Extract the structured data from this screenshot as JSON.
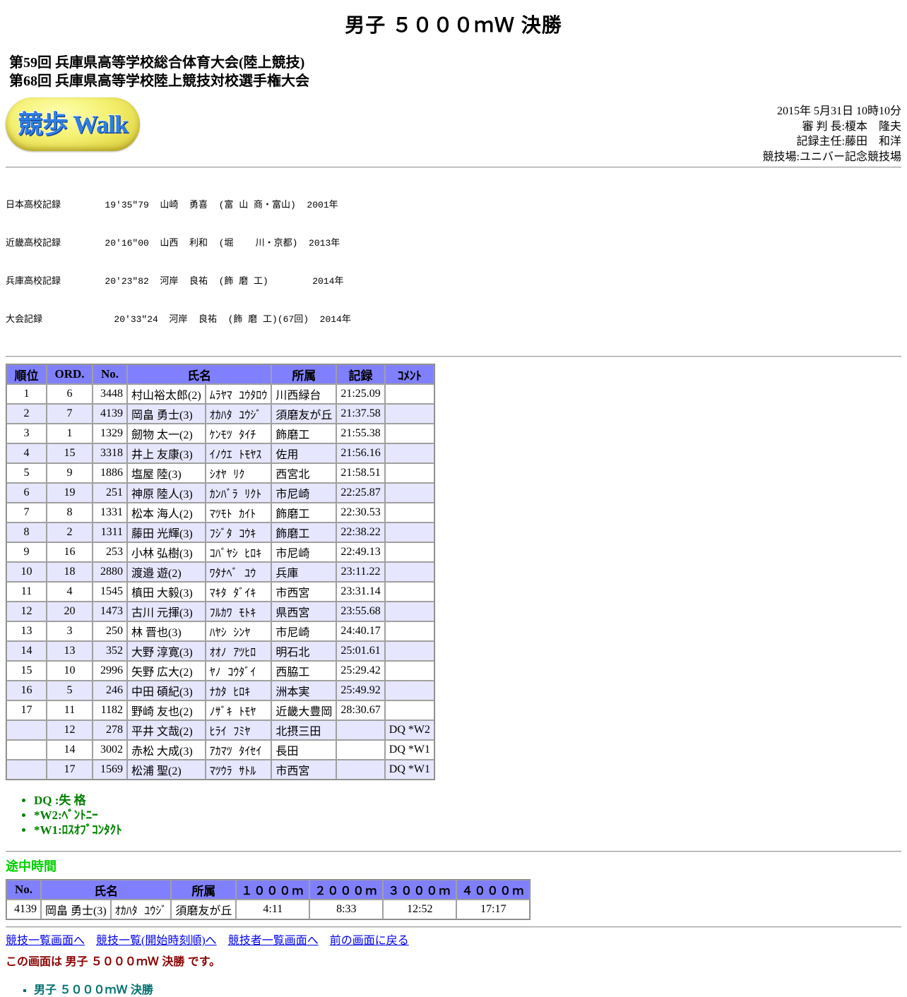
{
  "title": "男子 ５０００ｍＷ 決勝",
  "meet": {
    "line1": "第59回 兵庫県高等学校総合体育大会(陸上競技)",
    "line2": "第68回 兵庫県高等学校陸上競技対校選手権大会"
  },
  "logo": {
    "text": "競歩 Walk",
    "icon": "walk-logo-badge"
  },
  "officials": {
    "datetime": "2015年 5月31日 10時10分",
    "referee": "審 判 長:榎本　隆夫",
    "recorder": "記録主任:藤田　和洋",
    "venue": "競技場:ユニバー記念競技場"
  },
  "records": [
    "日本高校記録        19'35\"79  山崎  勇喜  (富 山 商・富山)  2001年",
    "近畿高校記録        20'16\"00  山西  利和  (堀    川・京都)  2013年",
    "兵庫高校記録        20'23\"82  河岸  良祐  (飾 磨 工)        2014年",
    "大会記録             20'33\"24  河岸  良祐  (飾 磨 工)(67回)  2014年"
  ],
  "results": {
    "headers": {
      "rank": "順位",
      "ord": "ORD.",
      "no": "No.",
      "name": "氏名",
      "team": "所属",
      "record": "記録",
      "comment": "ｺﾒﾝﾄ"
    },
    "rows": [
      {
        "rank": "1",
        "ord": "6",
        "no": "3448",
        "name": "村山裕太郎(2)",
        "kana": "ﾑﾗﾔﾏ ﾕｳﾀﾛｳ",
        "team": "川西緑台",
        "record": "21:25.09",
        "comment": ""
      },
      {
        "rank": "2",
        "ord": "7",
        "no": "4139",
        "name": "岡畠 勇士(3)",
        "kana": "ｵｶﾊﾀ ﾕｳｼﾞ",
        "team": "須磨友が丘",
        "record": "21:37.58",
        "comment": ""
      },
      {
        "rank": "3",
        "ord": "1",
        "no": "1329",
        "name": "劒物 太一(2)",
        "kana": "ｹﾝﾓﾂ ﾀｲﾁ",
        "team": "飾磨工",
        "record": "21:55.38",
        "comment": ""
      },
      {
        "rank": "4",
        "ord": "15",
        "no": "3318",
        "name": "井上 友康(3)",
        "kana": "ｲﾉｳｴ ﾄﾓﾔｽ",
        "team": "佐用",
        "record": "21:56.16",
        "comment": ""
      },
      {
        "rank": "5",
        "ord": "9",
        "no": "1886",
        "name": "塩屋 陸(3)",
        "kana": "ｼｵﾔ ﾘｸ",
        "team": "西宮北",
        "record": "21:58.51",
        "comment": ""
      },
      {
        "rank": "6",
        "ord": "19",
        "no": "251",
        "name": "神原 陸人(3)",
        "kana": "ｶﾝﾊﾞﾗ ﾘｸﾄ",
        "team": "市尼崎",
        "record": "22:25.87",
        "comment": ""
      },
      {
        "rank": "7",
        "ord": "8",
        "no": "1331",
        "name": "松本 海人(2)",
        "kana": "ﾏﾂﾓﾄ ｶｲﾄ",
        "team": "飾磨工",
        "record": "22:30.53",
        "comment": ""
      },
      {
        "rank": "8",
        "ord": "2",
        "no": "1311",
        "name": "藤田 光輝(3)",
        "kana": "ﾌｼﾞﾀ ｺｳｷ",
        "team": "飾磨工",
        "record": "22:38.22",
        "comment": ""
      },
      {
        "rank": "9",
        "ord": "16",
        "no": "253",
        "name": "小林 弘樹(3)",
        "kana": "ｺﾊﾞﾔｼ ﾋﾛｷ",
        "team": "市尼崎",
        "record": "22:49.13",
        "comment": ""
      },
      {
        "rank": "10",
        "ord": "18",
        "no": "2880",
        "name": "渡邉 遊(2)",
        "kana": "ﾜﾀﾅﾍﾞ ﾕｳ",
        "team": "兵庫",
        "record": "23:11.22",
        "comment": ""
      },
      {
        "rank": "11",
        "ord": "4",
        "no": "1545",
        "name": "槙田 大毅(3)",
        "kana": "ﾏｷﾀ ﾀﾞｲｷ",
        "team": "市西宮",
        "record": "23:31.14",
        "comment": ""
      },
      {
        "rank": "12",
        "ord": "20",
        "no": "1473",
        "name": "古川 元揮(3)",
        "kana": "ﾌﾙｶﾜ ﾓﾄｷ",
        "team": "県西宮",
        "record": "23:55.68",
        "comment": ""
      },
      {
        "rank": "13",
        "ord": "3",
        "no": "250",
        "name": "林 晋也(3)",
        "kana": "ﾊﾔｼ ｼﾝﾔ",
        "team": "市尼崎",
        "record": "24:40.17",
        "comment": ""
      },
      {
        "rank": "14",
        "ord": "13",
        "no": "352",
        "name": "大野 淳寛(3)",
        "kana": "ｵｵﾉ ｱﾂﾋﾛ",
        "team": "明石北",
        "record": "25:01.61",
        "comment": ""
      },
      {
        "rank": "15",
        "ord": "10",
        "no": "2996",
        "name": "矢野 広大(2)",
        "kana": "ﾔﾉ ｺｳﾀﾞｲ",
        "team": "西脇工",
        "record": "25:29.42",
        "comment": ""
      },
      {
        "rank": "16",
        "ord": "5",
        "no": "246",
        "name": "中田 碩紀(3)",
        "kana": "ﾅｶﾀ ﾋﾛｷ",
        "team": "洲本実",
        "record": "25:49.92",
        "comment": ""
      },
      {
        "rank": "17",
        "ord": "11",
        "no": "1182",
        "name": "野崎 友也(2)",
        "kana": "ﾉｻﾞｷ ﾄﾓﾔ",
        "team": "近畿大豊岡",
        "record": "28:30.67",
        "comment": ""
      },
      {
        "rank": "",
        "ord": "12",
        "no": "278",
        "name": "平井 文哉(2)",
        "kana": "ﾋﾗｲ ﾌﾐﾔ",
        "team": "北摂三田",
        "record": "",
        "comment": "DQ *W2"
      },
      {
        "rank": "",
        "ord": "14",
        "no": "3002",
        "name": "赤松 大成(3)",
        "kana": "ｱｶﾏﾂ ﾀｲｾｲ",
        "team": "長田",
        "record": "",
        "comment": "DQ *W1"
      },
      {
        "rank": "",
        "ord": "17",
        "no": "1569",
        "name": "松浦 聖(2)",
        "kana": "ﾏﾂｳﾗ ｻﾄﾙ",
        "team": "市西宮",
        "record": "",
        "comment": "DQ *W1"
      }
    ]
  },
  "legend": [
    "DQ :失 格",
    "*W2:ﾍﾞﾝﾄﾆｰ",
    "*W1:ﾛｽｵﾌﾞｺﾝﾀｸﾄ"
  ],
  "splits": {
    "title": "途中時間",
    "headers": {
      "no": "No.",
      "name": "氏名",
      "team": "所属",
      "lap1": "１０００ｍ",
      "lap2": "２０００ｍ",
      "lap3": "３０００ｍ",
      "lap4": "４０００ｍ"
    },
    "row": {
      "no": "4139",
      "name": "岡畠 勇士(3)",
      "kana": "ｵｶﾊﾀ ﾕｳｼﾞ",
      "team": "須磨友が丘",
      "lap1": "4:11",
      "lap2": "8:33",
      "lap3": "12:52",
      "lap4": "17:17"
    }
  },
  "links": [
    "競技一覧画面へ",
    "競技一覧(開始時刻順)へ",
    "競技者一覧画面へ",
    "前の画面に戻る"
  ],
  "current": "この画面は 男子 ５０００ｍＷ 決勝 です。",
  "bottom_item": "男子 ５０００ｍＷ 決勝",
  "colors": {
    "table_header": "#8080ff",
    "row_alt": "#e6e6ff",
    "legend": "#008000",
    "split_title": "#00d000",
    "link": "#0000ee",
    "current_text": "#8b0000",
    "bottom_item": "#007070"
  }
}
